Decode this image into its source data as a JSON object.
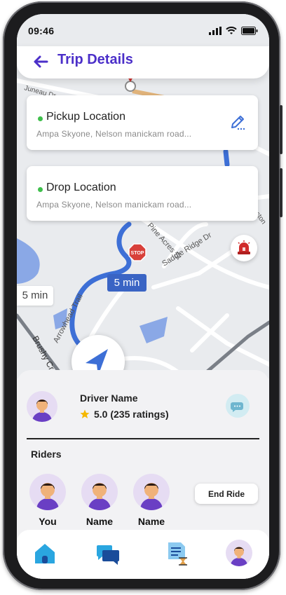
{
  "status_bar": {
    "time": "09:46"
  },
  "header": {
    "title": "Trip Details"
  },
  "pickup": {
    "label": "Pickup Location",
    "address": "Ampa Skyone, Nelson manickam road..."
  },
  "drop": {
    "label": "Drop Location",
    "address": "Ampa Skyone, Nelson manickam road..."
  },
  "map": {
    "eta_chip": "5 min",
    "eta_side_chip": "5 min",
    "stop_sign": "STOP",
    "streets": [
      "Juneau Dr",
      "Pine Acres St",
      "Saddle Ridge Dr",
      "Arrowhead Trail",
      "Brushy Cr",
      "ston"
    ]
  },
  "driver": {
    "name": "Driver Name",
    "rating": "5.0 (235 ratings)"
  },
  "riders": {
    "title": "Riders",
    "list": [
      {
        "name": "You"
      },
      {
        "name": "Name"
      },
      {
        "name": "Name"
      }
    ]
  },
  "end_ride_label": "End Ride",
  "bottom_nav": [
    "home-icon",
    "chat-icon",
    "trip-history-icon",
    "profile-icon"
  ],
  "colors": {
    "accent": "#4b2fc9",
    "route": "#3d6fd6",
    "pickup_dot": "#3fbf4c",
    "nav_active": "#2aa6e0"
  }
}
